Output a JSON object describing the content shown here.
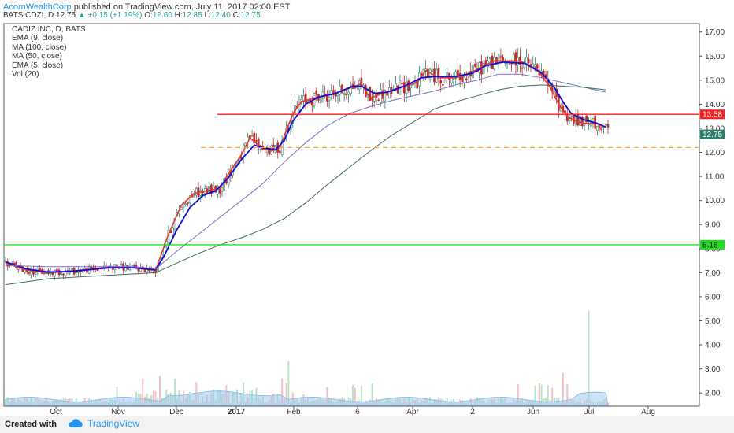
{
  "header": {
    "author": "AcornWealthCorp",
    "published_text": "published on TradingView.com, July 11, 2017 02:00 EST",
    "symbol": "BATS:CDZI, D",
    "last": "12.75",
    "change": "+0.15 (+1.19%)",
    "open_label": "O:",
    "open": "12.60",
    "high_label": "H:",
    "high": "12.85",
    "low_label": "L:",
    "low": "12.40",
    "close_label": "C:",
    "close": "12.75"
  },
  "legend": [
    "CADIZ INC, D, BATS",
    "EMA (9, close)",
    "MA (100, close)",
    "MA (50, close)",
    "EMA (5, close)",
    "Vol (20)"
  ],
  "footer": {
    "created": "Created with",
    "brand": "TradingView"
  },
  "colors": {
    "ema9": "#0c0cd6",
    "ema5": "#e53935",
    "ma50": "#7b6fc4",
    "ma100": "#3d6b5a",
    "resistance": "#ff1e1e",
    "support_line": "#22dd22",
    "dashed": "#f5a623",
    "candle_up": "#2e7d6b",
    "candle_down": "#c62828",
    "vol_up": "#b9e3c5",
    "vol_down": "#f3c1c1",
    "vol_ma": "#9ecbef"
  },
  "chart_data": {
    "type": "candlestick",
    "x_tick_labels": [
      "Oct",
      "Nov",
      "Dec",
      "2017",
      "Feb",
      "6",
      "Apr",
      "2",
      "Jun",
      "Jul",
      "Aug"
    ],
    "y_tick_labels": [
      "2.00",
      "3.00",
      "4.00",
      "5.00",
      "6.00",
      "7.00",
      "8.00",
      "9.00",
      "10.00",
      "11.00",
      "12.00",
      "13.00",
      "14.00",
      "15.00",
      "16.00",
      "17.00"
    ],
    "ylim": [
      1.45,
      17.35
    ],
    "grid": false,
    "series": [
      {
        "name": "EMA (5, close)",
        "points": [
          [
            0,
            7.4
          ],
          [
            10,
            7.1
          ],
          [
            20,
            7.0
          ],
          [
            30,
            7.05
          ],
          [
            40,
            7.15
          ],
          [
            50,
            7.25
          ],
          [
            60,
            7.2
          ],
          [
            70,
            7.1
          ],
          [
            72,
            7.6
          ],
          [
            76,
            8.6
          ],
          [
            82,
            9.8
          ],
          [
            88,
            10.3
          ],
          [
            94,
            10.4
          ],
          [
            100,
            10.5
          ],
          [
            104,
            11.1
          ],
          [
            110,
            11.9
          ],
          [
            114,
            12.6
          ],
          [
            118,
            12.3
          ],
          [
            124,
            12.05
          ],
          [
            128,
            12.2
          ],
          [
            131,
            12.9
          ],
          [
            134,
            13.6
          ],
          [
            138,
            14.1
          ],
          [
            146,
            14.3
          ],
          [
            152,
            14.4
          ],
          [
            160,
            14.65
          ],
          [
            166,
            14.85
          ],
          [
            170,
            14.25
          ],
          [
            176,
            14.45
          ],
          [
            184,
            14.7
          ],
          [
            192,
            14.9
          ],
          [
            196,
            15.4
          ],
          [
            202,
            15.1
          ],
          [
            210,
            15.1
          ],
          [
            216,
            15.25
          ],
          [
            222,
            15.55
          ],
          [
            228,
            15.8
          ],
          [
            240,
            15.8
          ],
          [
            248,
            15.45
          ],
          [
            254,
            14.7
          ],
          [
            258,
            14.0
          ],
          [
            262,
            13.5
          ],
          [
            266,
            13.3
          ],
          [
            270,
            13.2
          ],
          [
            276,
            13.2
          ],
          [
            278,
            12.95
          ]
        ]
      },
      {
        "name": "EMA (9, close)",
        "points": [
          [
            0,
            7.45
          ],
          [
            10,
            7.15
          ],
          [
            20,
            7.02
          ],
          [
            30,
            7.05
          ],
          [
            40,
            7.13
          ],
          [
            50,
            7.22
          ],
          [
            60,
            7.2
          ],
          [
            70,
            7.12
          ],
          [
            74,
            7.7
          ],
          [
            80,
            8.8
          ],
          [
            86,
            9.7
          ],
          [
            92,
            10.2
          ],
          [
            98,
            10.4
          ],
          [
            104,
            10.95
          ],
          [
            110,
            11.7
          ],
          [
            116,
            12.3
          ],
          [
            120,
            12.2
          ],
          [
            126,
            12.1
          ],
          [
            130,
            12.5
          ],
          [
            134,
            13.3
          ],
          [
            140,
            14.0
          ],
          [
            146,
            14.3
          ],
          [
            154,
            14.45
          ],
          [
            162,
            14.75
          ],
          [
            166,
            14.75
          ],
          [
            172,
            14.45
          ],
          [
            178,
            14.5
          ],
          [
            186,
            14.75
          ],
          [
            194,
            15.1
          ],
          [
            200,
            15.15
          ],
          [
            210,
            15.15
          ],
          [
            218,
            15.3
          ],
          [
            224,
            15.6
          ],
          [
            232,
            15.75
          ],
          [
            242,
            15.7
          ],
          [
            250,
            15.3
          ],
          [
            256,
            14.7
          ],
          [
            260,
            14.1
          ],
          [
            264,
            13.6
          ],
          [
            270,
            13.35
          ],
          [
            276,
            13.2
          ],
          [
            280,
            13.05
          ]
        ]
      },
      {
        "name": "MA (50, close)",
        "points": [
          [
            0,
            7.3
          ],
          [
            20,
            7.25
          ],
          [
            40,
            7.25
          ],
          [
            60,
            7.25
          ],
          [
            70,
            7.15
          ],
          [
            80,
            7.9
          ],
          [
            90,
            8.6
          ],
          [
            100,
            9.3
          ],
          [
            110,
            10.0
          ],
          [
            120,
            10.7
          ],
          [
            130,
            11.6
          ],
          [
            140,
            12.4
          ],
          [
            150,
            13.1
          ],
          [
            160,
            13.6
          ],
          [
            170,
            13.9
          ],
          [
            180,
            14.15
          ],
          [
            190,
            14.35
          ],
          [
            200,
            14.55
          ],
          [
            210,
            14.8
          ],
          [
            220,
            15.0
          ],
          [
            230,
            15.25
          ],
          [
            240,
            15.25
          ],
          [
            250,
            15.1
          ],
          [
            260,
            14.9
          ],
          [
            270,
            14.7
          ],
          [
            280,
            14.5
          ]
        ]
      },
      {
        "name": "MA (100, close)",
        "points": [
          [
            0,
            6.5
          ],
          [
            20,
            6.75
          ],
          [
            40,
            6.85
          ],
          [
            60,
            6.95
          ],
          [
            70,
            7.0
          ],
          [
            80,
            7.4
          ],
          [
            90,
            7.8
          ],
          [
            100,
            8.15
          ],
          [
            110,
            8.45
          ],
          [
            120,
            8.8
          ],
          [
            130,
            9.25
          ],
          [
            140,
            9.9
          ],
          [
            150,
            10.65
          ],
          [
            160,
            11.35
          ],
          [
            170,
            12.05
          ],
          [
            180,
            12.7
          ],
          [
            190,
            13.25
          ],
          [
            200,
            13.8
          ],
          [
            210,
            14.1
          ],
          [
            220,
            14.35
          ],
          [
            230,
            14.6
          ],
          [
            240,
            14.75
          ],
          [
            250,
            14.8
          ],
          [
            260,
            14.75
          ],
          [
            270,
            14.7
          ],
          [
            280,
            14.6
          ]
        ]
      }
    ],
    "horizontal_lines": [
      {
        "label": "13.58",
        "value": 13.58,
        "style": "solid",
        "color": "#ff1e1e"
      },
      {
        "label": "8.16",
        "value": 8.16,
        "style": "solid",
        "color": "#22dd22"
      },
      {
        "label": "12.20",
        "value": 12.2,
        "style": "dashed",
        "color": "#f5a623"
      }
    ],
    "last_price_label": {
      "label": "12.75",
      "value": 12.75
    },
    "volume_spikes": [
      {
        "bar": 132,
        "value": 3.3
      },
      {
        "bar": 260,
        "value": 2.8
      },
      {
        "bar": 272,
        "value": 5.4
      }
    ]
  }
}
